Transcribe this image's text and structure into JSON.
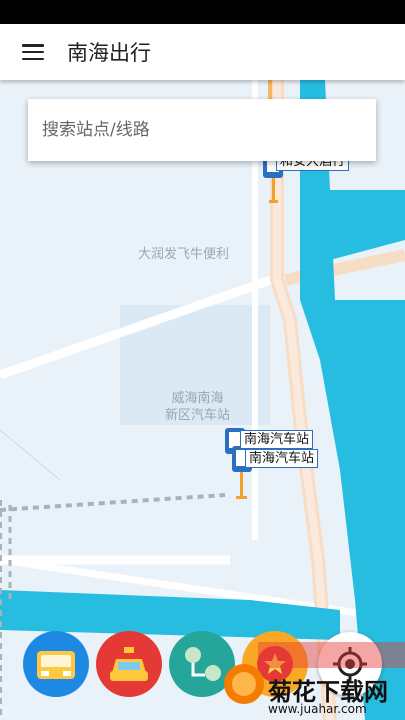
{
  "app": {
    "title": "南海出行"
  },
  "search": {
    "placeholder": "搜索站点/线路"
  },
  "map": {
    "pois": [
      "大润发飞牛便利",
      "威海南海\n新区汽车站"
    ],
    "stops": [
      {
        "label": "南海汽车站"
      },
      {
        "label": "南海汽车站"
      },
      {
        "label": "和安大酒行"
      }
    ]
  },
  "bottom_buttons": [
    {
      "name": "bus",
      "color": "#1e88e5"
    },
    {
      "name": "taxi",
      "color": "#e53935"
    },
    {
      "name": "route",
      "color": "#26a69a"
    },
    {
      "name": "favorite",
      "color": "#f9a825"
    }
  ],
  "watermark": {
    "brand": "菊花下载网",
    "url": "www.juahar.com"
  }
}
